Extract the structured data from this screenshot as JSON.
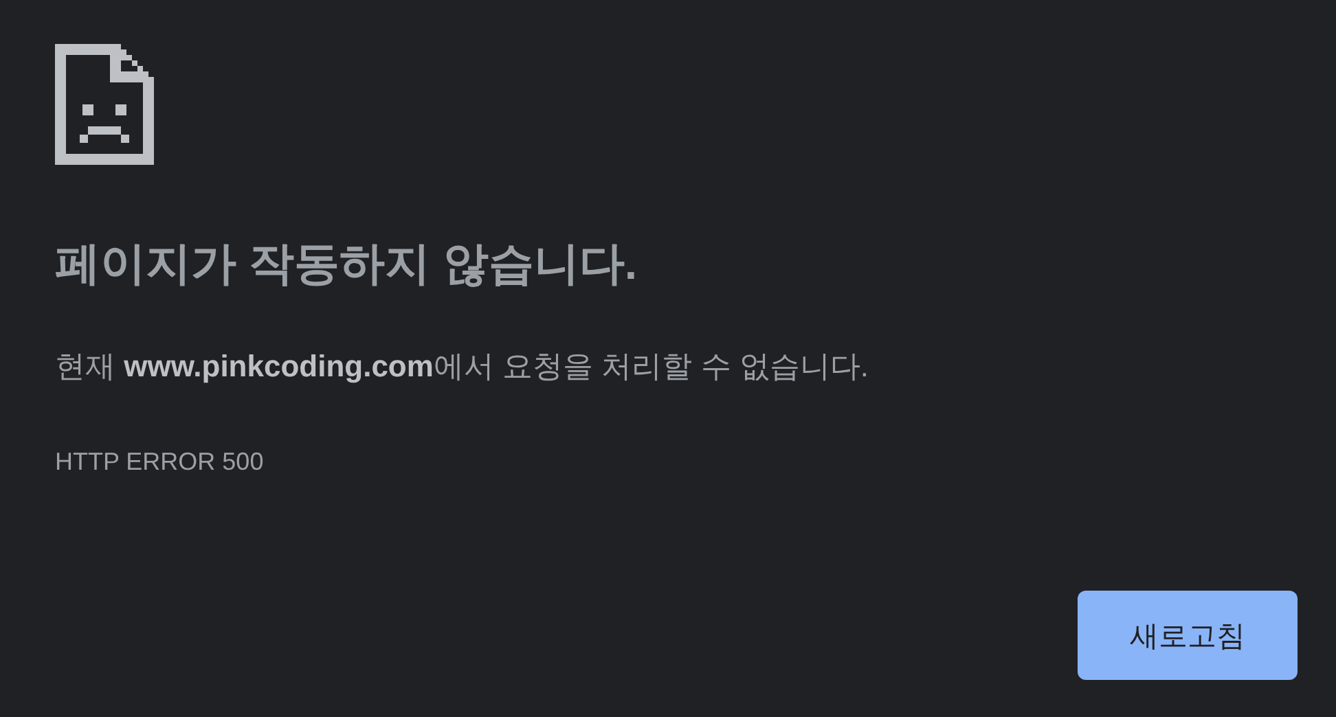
{
  "title": "페이지가 작동하지 않습니다.",
  "message": "현재 **www.pinkcoding.com**에서 요청을 처리할 수 없습니다.",
  "error_code": "HTTP ERROR 500",
  "buttons": [
    {
      "label": "새로고침"
    }
  ]
}
